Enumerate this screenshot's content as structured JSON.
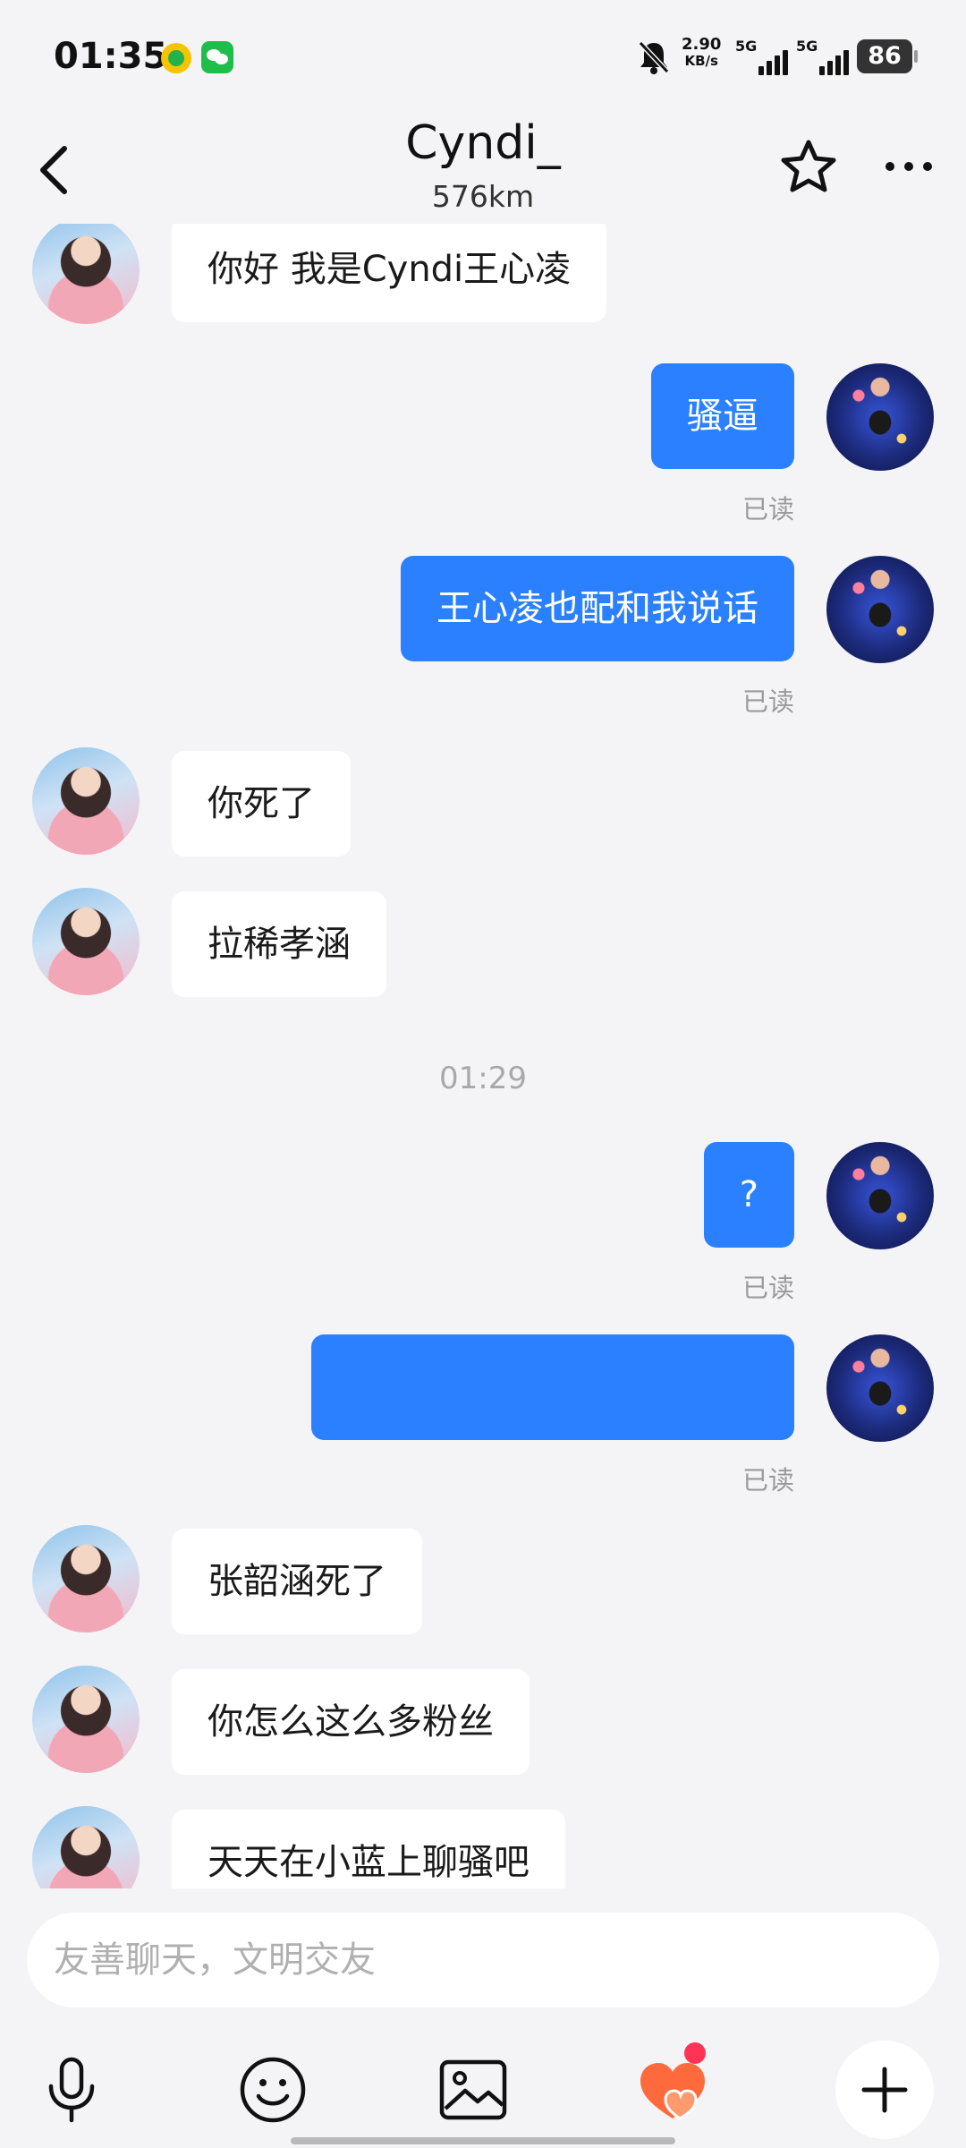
{
  "status_bar": {
    "time": "01:35",
    "speed_value": "2.90",
    "speed_unit": "KB/s",
    "sim1_label": "5G",
    "sim2_label": "5G",
    "battery": "86"
  },
  "header": {
    "title": "Cyndi_",
    "subtitle": "576km",
    "icons": [
      "back-icon",
      "star-icon",
      "more-icon"
    ]
  },
  "messages": [
    {
      "side": "in",
      "text": "你好 我是Cyndi王心凌"
    },
    {
      "side": "out",
      "text": "骚逼",
      "read": "已读"
    },
    {
      "side": "out",
      "text": "王心凌也配和我说话",
      "read": "已读"
    },
    {
      "side": "in",
      "text": "你死了"
    },
    {
      "side": "in",
      "text": "拉稀孝涵"
    },
    {
      "side": "out",
      "text": "?",
      "read": "已读"
    },
    {
      "side": "out",
      "text": "",
      "read": "已读"
    },
    {
      "side": "in",
      "text": "张韶涵死了"
    },
    {
      "side": "in",
      "text": "你怎么这么多粉丝"
    },
    {
      "side": "in",
      "text": "天天在小蓝上聊骚吧"
    }
  ],
  "timestamp": "01:29",
  "input": {
    "placeholder": "友善聊天，文明交友"
  },
  "toolbar": {
    "icons": [
      "microphone-icon",
      "emoji-icon",
      "image-icon",
      "hearts-gift-icon",
      "plus-icon"
    ]
  },
  "colors": {
    "accent": "#2a80ff",
    "background": "#f4f4f6",
    "incoming_bubble": "#ffffff",
    "badge": "#ff3356"
  }
}
